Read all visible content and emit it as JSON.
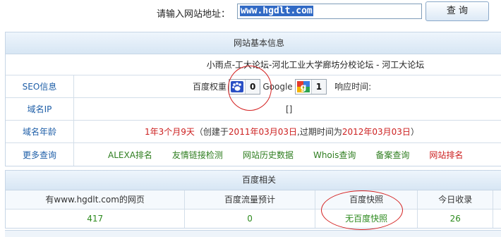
{
  "search": {
    "label": "请输入网站地址：",
    "value": "www.hgdlt.com",
    "button": "查 询"
  },
  "basic": {
    "title": "网站基本信息",
    "site_title": "小雨点-工大论坛-河北工业大学廊坊分校论坛 - 河工大论坛",
    "seo": {
      "label": "SEO信息",
      "baidu_label": "百度权重",
      "baidu_value": "0",
      "google_label": "Google",
      "google_value": "1",
      "response_label": "响应时间:"
    },
    "ip": {
      "label": "域名IP",
      "value": "[]"
    },
    "age": {
      "label": "域名年龄",
      "age": "1年3个月9天",
      "created_prefix": "（创建于",
      "created": "2011年03月03日",
      "expire_prefix": ",过期时间为",
      "expire": "2012年03月03日",
      "suffix": "）"
    },
    "more": {
      "label": "更多查询",
      "links": [
        "ALEXA排名",
        "友情链接检测",
        "网站历史数据",
        "Whois查询",
        "备案查询"
      ],
      "last_link": "网站排名"
    }
  },
  "baidu": {
    "title": "百度相关",
    "headers": [
      "有www.hgdlt.com的网页",
      "百度流量预计",
      "百度快照",
      "今日收录"
    ],
    "values": [
      "417",
      "0",
      "无百度快照",
      "26"
    ]
  },
  "colors": {
    "accent_blue": "#1f5fa8",
    "red": "#cc1f1f",
    "green": "#2e7d1f",
    "annotation_red": "#d42020"
  }
}
